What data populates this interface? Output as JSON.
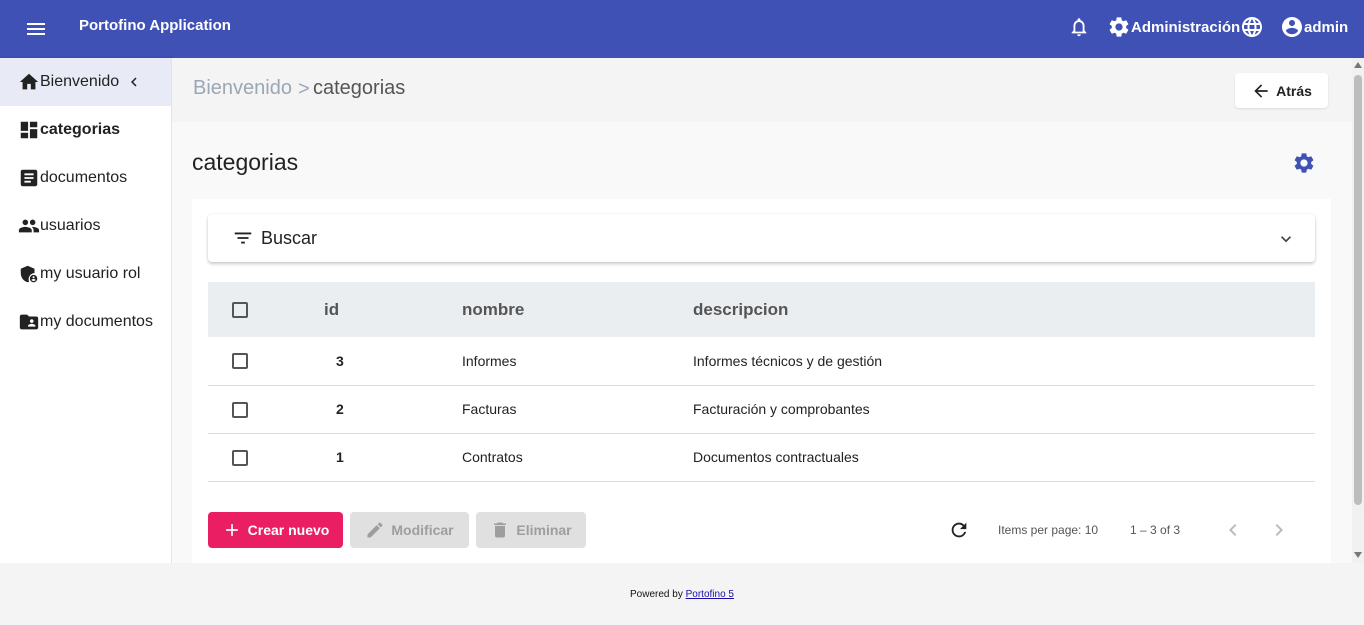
{
  "app": {
    "title": "Portofino Application"
  },
  "toolbar": {
    "admin_label": "Administración",
    "user_label": "admin"
  },
  "sidebar": {
    "items": [
      {
        "label": "Bienvenido",
        "icon": "home-icon"
      },
      {
        "label": "categorias",
        "icon": "dashboard-icon"
      },
      {
        "label": "documentos",
        "icon": "article-icon"
      },
      {
        "label": "usuarios",
        "icon": "group-icon"
      },
      {
        "label": "my usuario rol",
        "icon": "admin-shield-icon"
      },
      {
        "label": "my documentos",
        "icon": "folder-user-icon"
      }
    ]
  },
  "breadcrumb": {
    "home": "Bienvenido",
    "separator": ">",
    "current": "categorias"
  },
  "back_button": {
    "label": "Atrás"
  },
  "page": {
    "title": "categorias"
  },
  "search": {
    "label": "Buscar"
  },
  "table": {
    "headers": {
      "id": "id",
      "nombre": "nombre",
      "descripcion": "descripcion"
    },
    "rows": [
      {
        "id": "3",
        "nombre": "Informes",
        "descripcion": "Informes técnicos y de gestión"
      },
      {
        "id": "2",
        "nombre": "Facturas",
        "descripcion": "Facturación y comprobantes"
      },
      {
        "id": "1",
        "nombre": "Contratos",
        "descripcion": "Documentos contractuales"
      }
    ]
  },
  "actions": {
    "create": "Crear nuevo",
    "edit": "Modificar",
    "delete": "Eliminar"
  },
  "pagination": {
    "items_per_page": "Items per page: 10",
    "range": "1 – 3 of 3"
  },
  "footer": {
    "prefix": "Powered by",
    "link": "Portofino 5"
  },
  "colors": {
    "primary": "#3f51b5",
    "accent": "#e91e63"
  }
}
